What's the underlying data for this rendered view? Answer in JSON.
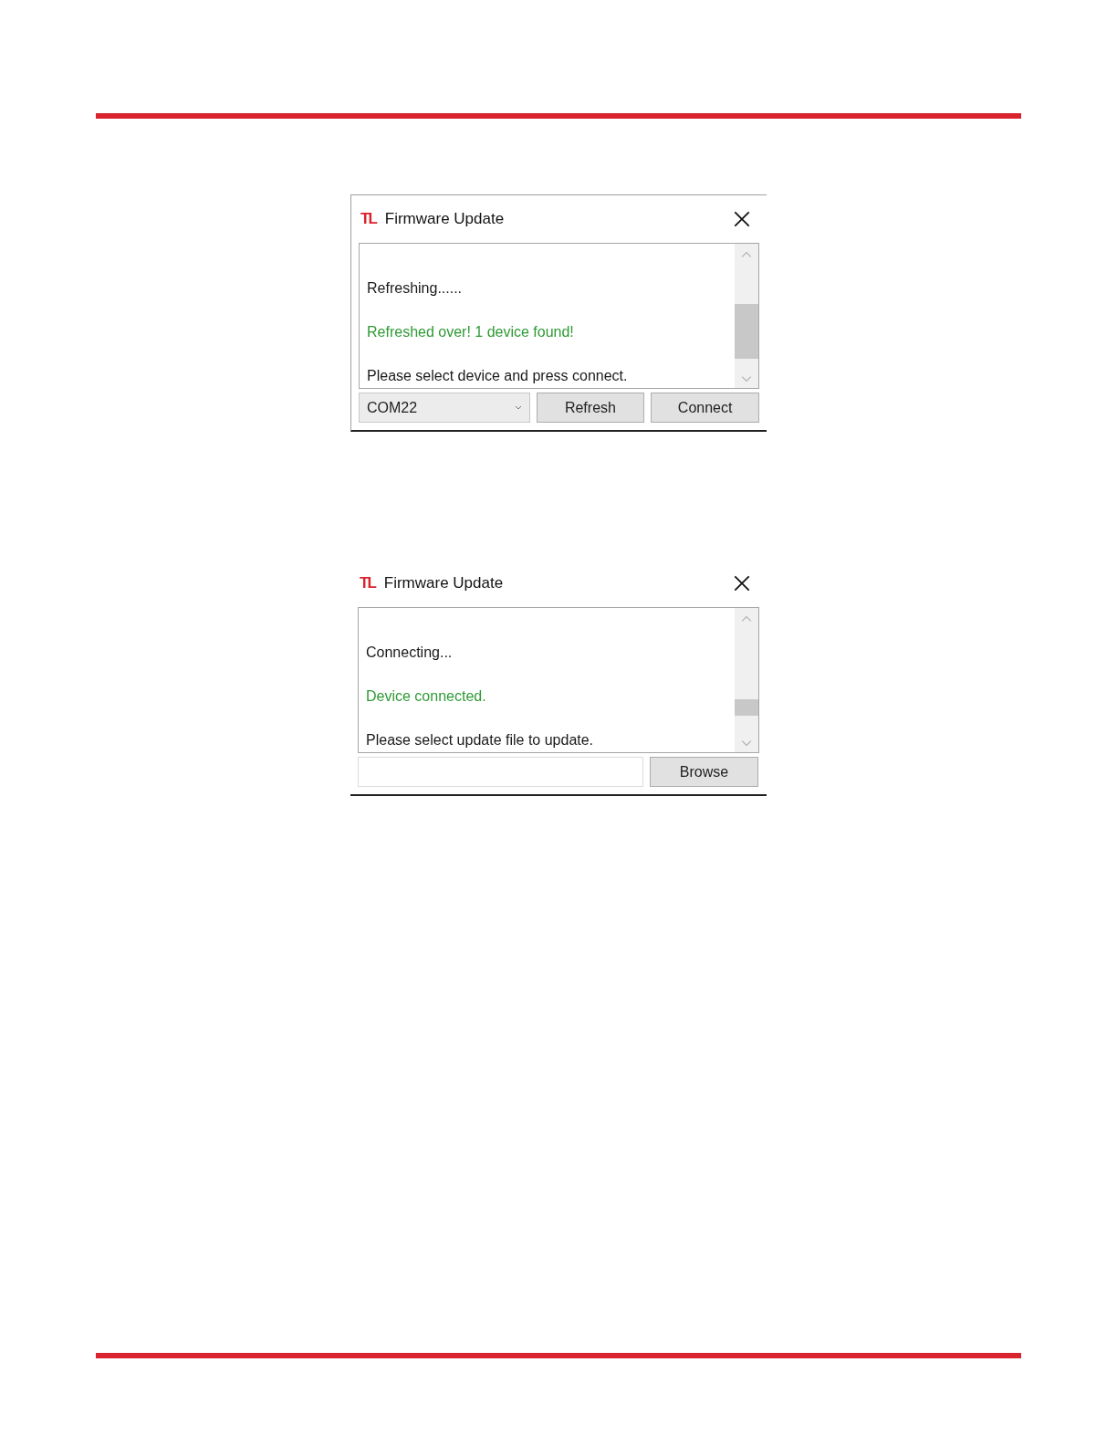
{
  "windows": [
    {
      "kind": "connect",
      "logo": "TL",
      "title": "Firmware Update",
      "messages": [
        {
          "text": "Refreshing......",
          "color": "#1a1a1a"
        },
        {
          "text": "Refreshed over! 1 device found!",
          "color": "#2e9a35"
        },
        {
          "text": "Please select device and press connect.",
          "color": "#1a1a1a"
        }
      ],
      "port": "COM22",
      "buttons": [
        "Refresh",
        "Connect"
      ]
    },
    {
      "kind": "browse",
      "logo": "TL",
      "title": "Firmware Update",
      "messages": [
        {
          "text": "Connecting...",
          "color": "#1a1a1a"
        },
        {
          "text": "Device connected.",
          "color": "#2e9a35"
        },
        {
          "text": "Please select update file to update.",
          "color": "#1a1a1a"
        }
      ],
      "buttons": [
        "Browse"
      ]
    }
  ]
}
